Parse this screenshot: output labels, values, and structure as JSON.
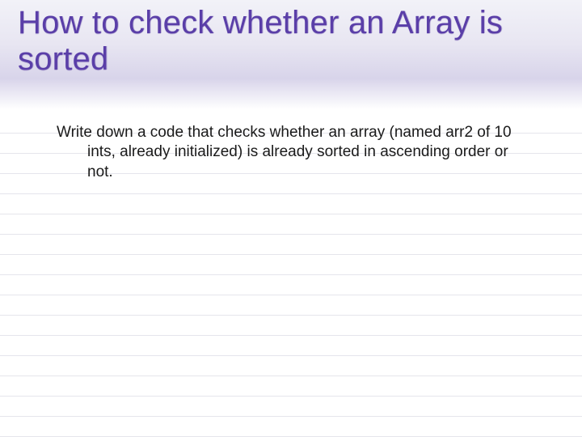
{
  "title": "How to check whether an Array is sorted",
  "body": "Write down a code that checks whether an array (named arr2 of 10 ints, already initialized) is already sorted in ascending order or not."
}
